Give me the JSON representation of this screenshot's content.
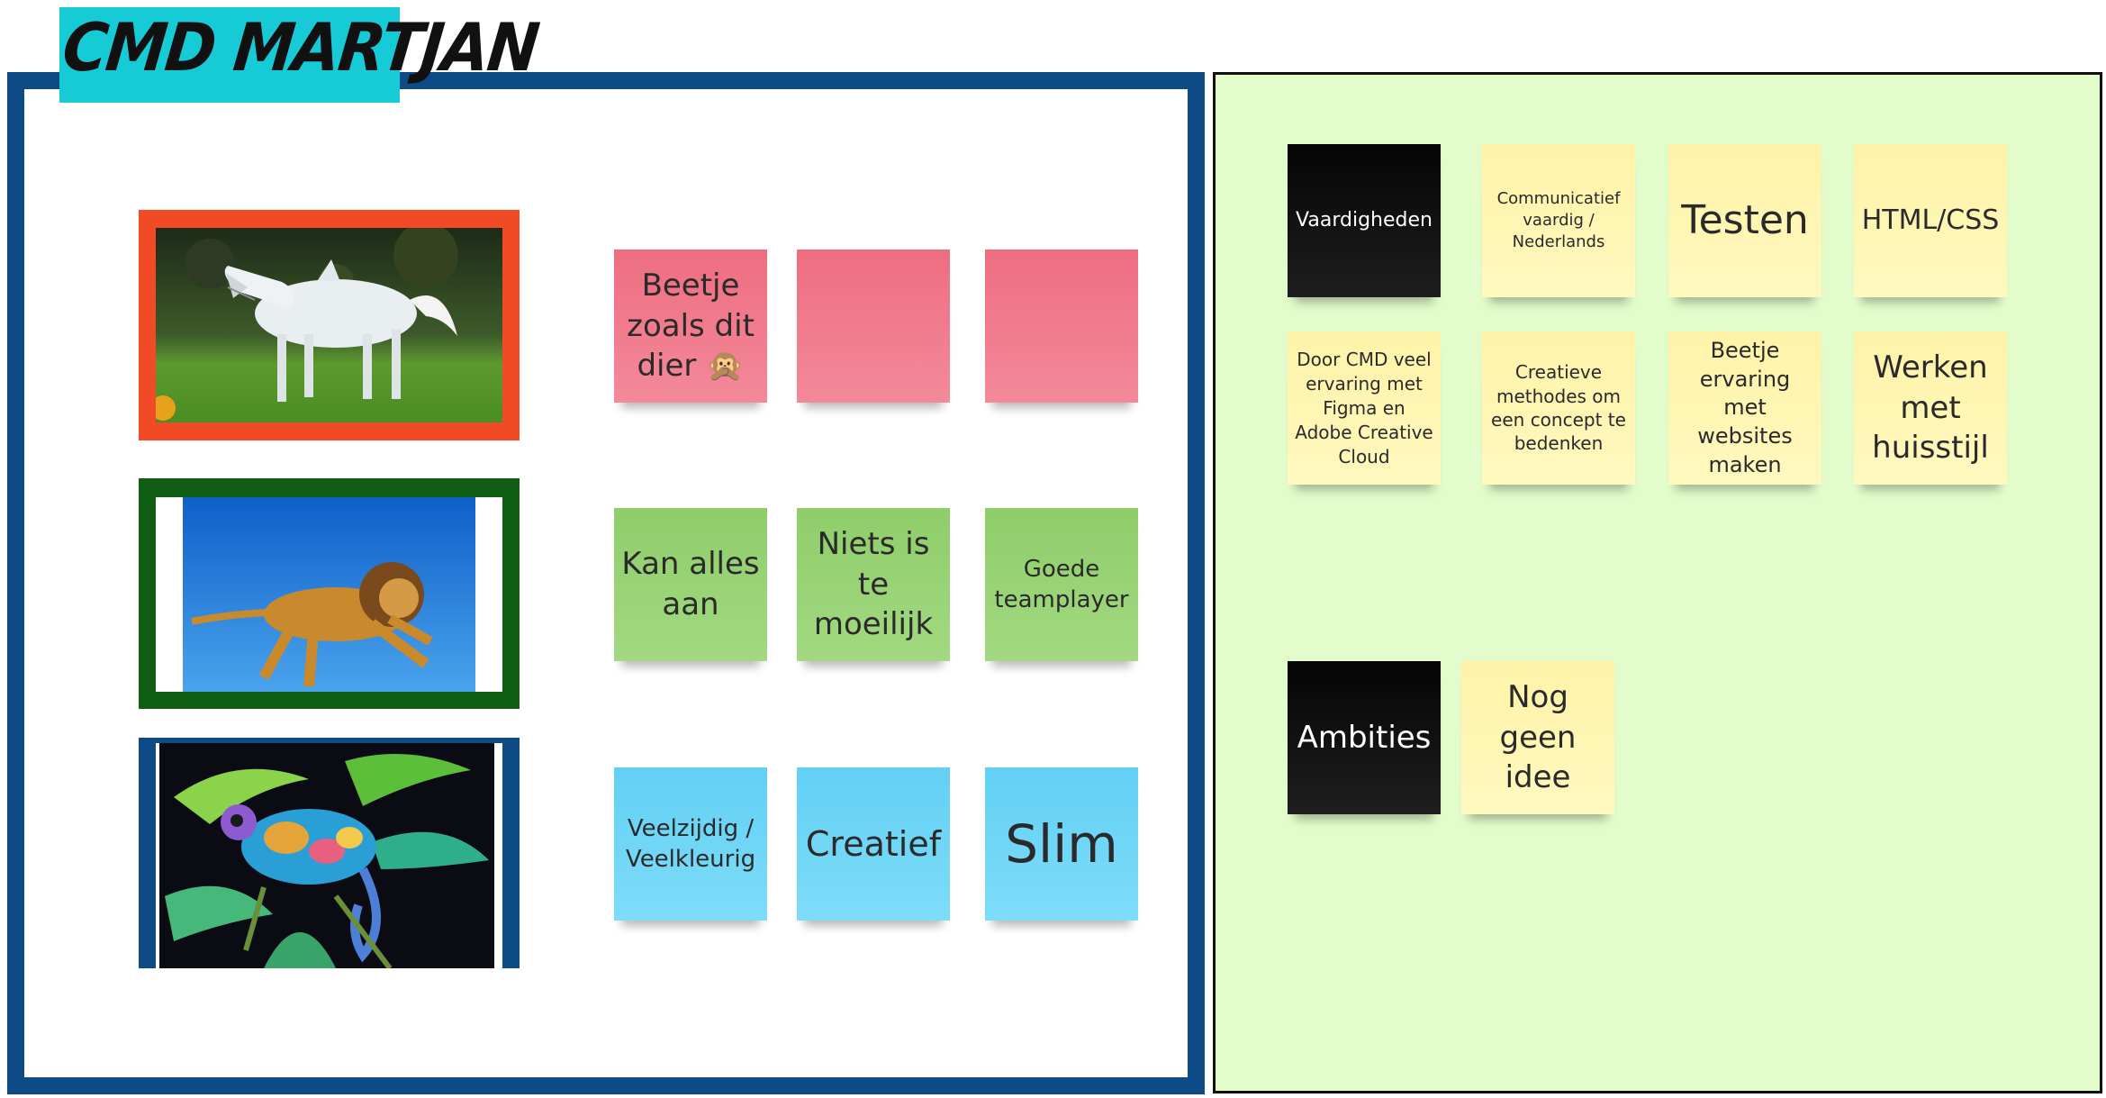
{
  "board": {
    "title": "CMD MARTJAN"
  },
  "images": {
    "shark_horse": "shark-horse-photo",
    "lion": "leaping-lion-photo",
    "chameleon": "chameleon-photo"
  },
  "notes_left": {
    "row1": [
      "Beetje zoals dit dier 🙊",
      "",
      ""
    ],
    "row2": [
      "Kan alles aan",
      "Niets is te moeilijk",
      "Goede teamplayer"
    ],
    "row3": [
      "Veelzijdig / Veelkleurig",
      "Creatief",
      "Slim"
    ]
  },
  "notes_right": {
    "skills_header": "Vaardigheden",
    "skills": [
      "Communicatief vaardig / Nederlands",
      "Testen",
      "HTML/CSS",
      "Door CMD veel ervaring met Figma en Adobe Creative Cloud",
      "Creatieve methodes om een concept te bedenken",
      "Beetje ervaring met websites maken",
      "Werken met huisstijl"
    ],
    "ambitions_header": "Ambities",
    "ambitions": [
      "Nog geen idee"
    ]
  },
  "colors": {
    "title_tag": "#17cbd6",
    "left_frame": "#0d4a86",
    "right_panel": "#e3fccb",
    "photo_border_red": "#f04a26",
    "photo_border_green": "#0f5e14",
    "photo_border_blue": "#0d4a86",
    "note_pink": "#f07b8d",
    "note_green": "#98d277",
    "note_blue": "#6dd5f5",
    "note_yellow": "#fff5b3"
  }
}
